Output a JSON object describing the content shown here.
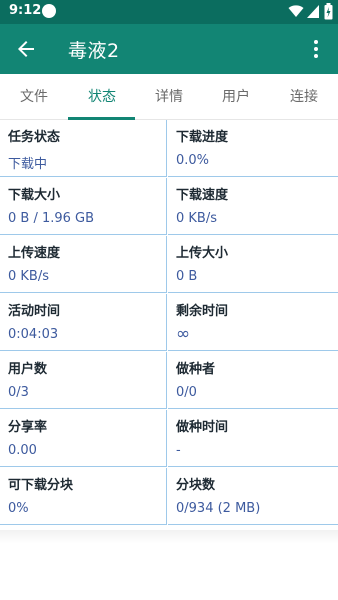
{
  "status_bar": {
    "time": "9:12"
  },
  "app_bar": {
    "title": "毒液2"
  },
  "tabs": [
    {
      "label": "文件"
    },
    {
      "label": "状态"
    },
    {
      "label": "详情"
    },
    {
      "label": "用户"
    },
    {
      "label": "连接"
    }
  ],
  "active_tab": "状态",
  "stats": [
    {
      "label": "任务状态",
      "value": "下载中"
    },
    {
      "label": "下载进度",
      "value": "0.0%"
    },
    {
      "label": "下载大小",
      "value": "0 B / 1.96 GB"
    },
    {
      "label": "下载速度",
      "value": "0 KB/s"
    },
    {
      "label": "上传速度",
      "value": "0 KB/s"
    },
    {
      "label": "上传大小",
      "value": "0 B"
    },
    {
      "label": "活动时间",
      "value": "0:04:03"
    },
    {
      "label": "剩余时间",
      "value": "∞"
    },
    {
      "label": "用户数",
      "value": "0/3"
    },
    {
      "label": "做种者",
      "value": "0/0"
    },
    {
      "label": "分享率",
      "value": "0.00"
    },
    {
      "label": "做种时间",
      "value": "-"
    },
    {
      "label": "可下载分块",
      "value": "0%"
    },
    {
      "label": "分块数",
      "value": "0/934 (2 MB)"
    }
  ],
  "colors": {
    "status_bar": "#0b6d5f",
    "app_bar": "#128574",
    "accent": "#128574",
    "divider": "#9ec9ea",
    "value_text": "#3d5a9e"
  }
}
